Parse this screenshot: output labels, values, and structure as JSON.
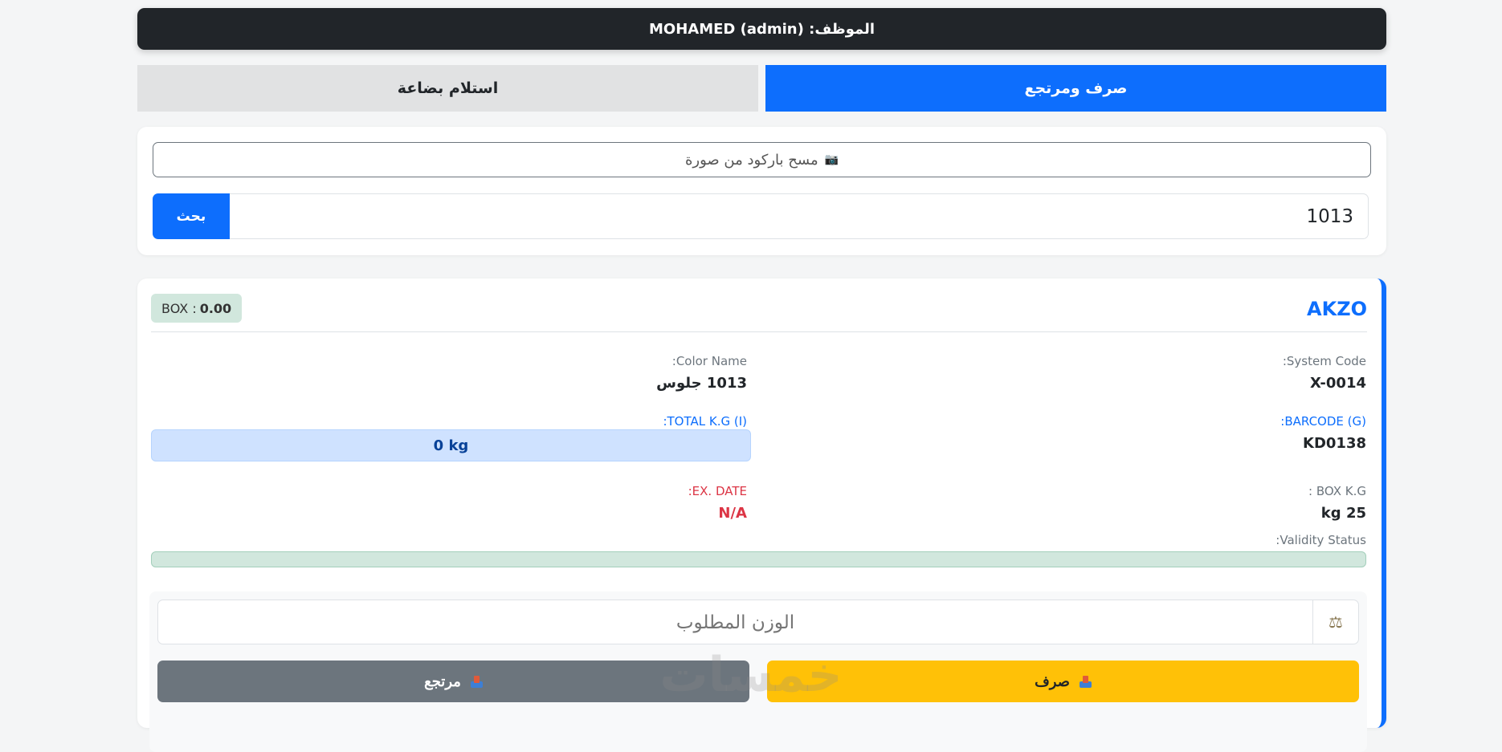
{
  "header": {
    "title": "الموظف: MOHAMED (admin)"
  },
  "tabs": [
    {
      "label": "صرف ومرتجع",
      "active": true
    },
    {
      "label": "استلام بضاعة",
      "active": false
    }
  ],
  "search": {
    "scan_label": "مسح باركود من صورة",
    "camera_icon": "📷",
    "query_value": "1013",
    "button_label": "بحث"
  },
  "product": {
    "brand": "AKZO",
    "box_badge_prefix": "BOX :",
    "box_badge_value": "0.00",
    "system_code_label": "System Code:",
    "system_code_value": "X-0014",
    "color_name_label": "Color Name:",
    "color_name_value": "1013 جلوس",
    "barcode_label": "BARCODE (G):",
    "barcode_value": "KD0138",
    "total_kg_label": "TOTAL K.G (I):",
    "total_kg_value": "0 kg",
    "box_kg_label": "BOX K.G :",
    "box_kg_value": "25 kg",
    "ex_date_label": "EX. DATE:",
    "ex_date_value": "N/A",
    "validity_label": "Validity Status:"
  },
  "actions": {
    "scale_icon": "⚖",
    "weight_placeholder": "الوزن المطلوب",
    "issue_label": "صرف",
    "return_label": "مرتجع"
  },
  "watermark": "خمسات",
  "colors": {
    "primary": "#0d6efd",
    "dark": "#212529",
    "warning": "#ffc107",
    "secondary": "#6c757d",
    "success_light": "#d1e7dd",
    "danger": "#dc3545"
  }
}
